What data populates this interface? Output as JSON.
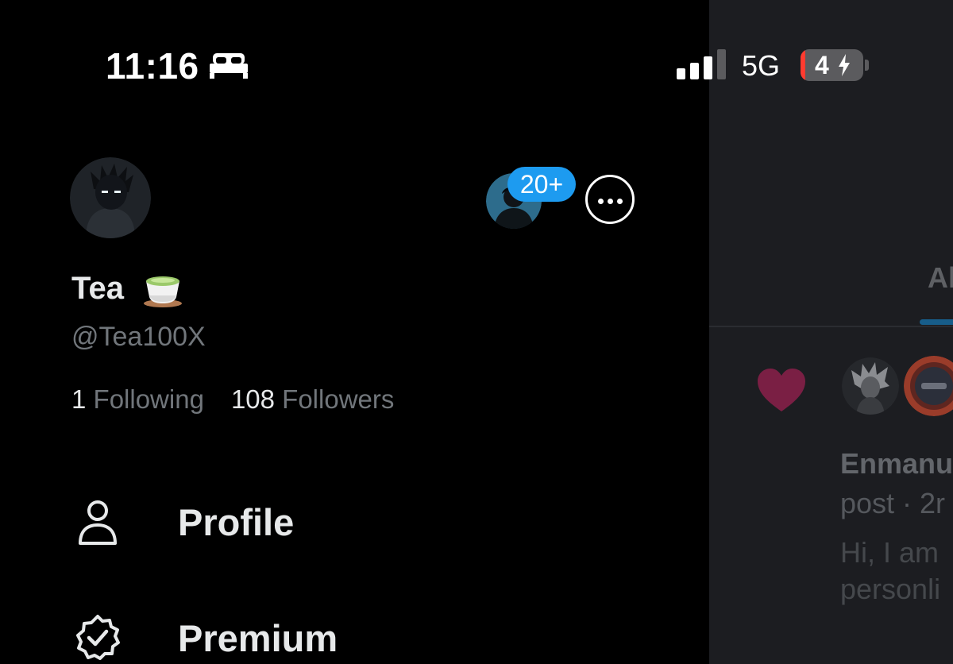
{
  "status_bar": {
    "time": "11:16",
    "sleep_icon": "bed-icon",
    "signal_icon": "cellular-signal-icon",
    "network": "5G",
    "battery_level": "4",
    "battery_charging_icon": "bolt-icon",
    "battery_low_color": "#ff3b30"
  },
  "drawer": {
    "account_badge": "20+",
    "badge_color": "#1d9bf0",
    "more_icon": "more-horizontal-icon",
    "profile": {
      "name": "Tea",
      "name_emoji_icon": "teacup-emoji-icon",
      "handle": "@Tea100X",
      "following_count": "1",
      "following_label": "Following",
      "followers_count": "108",
      "followers_label": "Followers"
    },
    "menu": [
      {
        "label": "Profile",
        "icon": "person-icon"
      },
      {
        "label": "Premium",
        "icon": "verified-badge-icon"
      }
    ]
  },
  "background_timeline": {
    "tab_label": "Al",
    "heart_icon": "heart-icon",
    "notification_name": "Enmanu",
    "notification_meta": "post · 2r",
    "notification_line1": "Hi, I am",
    "notification_line2": "personli"
  }
}
